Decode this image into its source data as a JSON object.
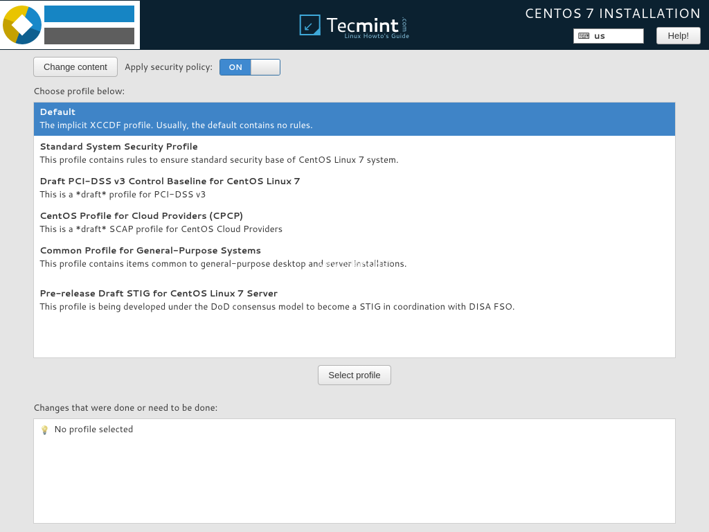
{
  "header": {
    "install_title": "CENTOS 7 INSTALLATION",
    "keyboard_layout": "us",
    "help_label": "Help!",
    "brand_main": "Tec",
    "brand_bold": "mint",
    "brand_suffix": ".com",
    "brand_tagline": "Linux Howto's Guide"
  },
  "toolbar": {
    "change_content_label": "Change content",
    "apply_policy_label": "Apply security policy:",
    "toggle_state": "ON"
  },
  "choose_label": "Choose profile below:",
  "profiles": [
    {
      "title": "Default",
      "desc": "The implicit XCCDF profile. Usually, the default contains no rules.",
      "selected": true
    },
    {
      "title": "Standard System Security Profile",
      "desc": "This profile contains rules to ensure standard security base of CentOS Linux 7 system."
    },
    {
      "title": "Draft PCI-DSS v3 Control Baseline for CentOS Linux 7",
      "desc": "This is a *draft* profile for PCI-DSS v3"
    },
    {
      "title": "CentOS Profile for Cloud Providers (CPCP)",
      "desc": "This is a *draft* SCAP profile for CentOS Cloud Providers"
    },
    {
      "title": "Common Profile for General-Purpose Systems",
      "desc": "This profile contains items common to general-purpose desktop and server installations."
    },
    {
      "title": "Pre-release Draft STIG for CentOS Linux 7 Server",
      "desc": "This profile is being developed under the DoD consensus model to become a STIG in coordination with DISA FSO."
    }
  ],
  "select_profile_label": "Select profile",
  "changes_label": "Changes that were done or need to be done:",
  "changes_status": "No profile selected",
  "watermark": "www.pHome.NET"
}
